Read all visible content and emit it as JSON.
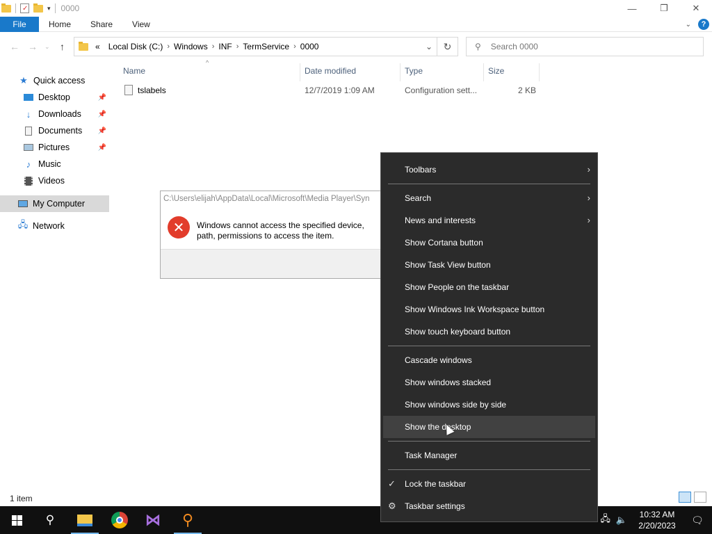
{
  "window": {
    "title": "0000",
    "controls": {
      "minimize_icon": "minimize-icon",
      "maximize_icon": "restore-icon",
      "close_icon": "close-icon"
    }
  },
  "ribbon": {
    "tabs": [
      {
        "label": "File"
      },
      {
        "label": "Home"
      },
      {
        "label": "Share"
      },
      {
        "label": "View"
      }
    ],
    "accent": "#1979ca"
  },
  "address": {
    "overflow": "«",
    "crumbs": [
      "Local Disk (C:)",
      "Windows",
      "INF",
      "TermService",
      "0000"
    ]
  },
  "search": {
    "placeholder": "Search 0000"
  },
  "sidebar": {
    "items": [
      {
        "label": "Quick access",
        "icon": "star-icon"
      },
      {
        "label": "Desktop",
        "icon": "desktop-icon",
        "pinned": true
      },
      {
        "label": "Downloads",
        "icon": "download-icon",
        "pinned": true
      },
      {
        "label": "Documents",
        "icon": "documents-icon",
        "pinned": true
      },
      {
        "label": "Pictures",
        "icon": "pictures-icon",
        "pinned": true
      },
      {
        "label": "Music",
        "icon": "music-icon"
      },
      {
        "label": "Videos",
        "icon": "videos-icon"
      },
      {
        "label": "My Computer",
        "icon": "computer-icon",
        "selected": true
      },
      {
        "label": "Network",
        "icon": "network-icon"
      }
    ]
  },
  "filelist": {
    "columns": [
      "Name",
      "Date modified",
      "Type",
      "Size"
    ],
    "rows": [
      {
        "name": "tslabels",
        "date": "12/7/2019 1:09 AM",
        "type": "Configuration sett...",
        "size": "2 KB"
      }
    ]
  },
  "error_dialog": {
    "path": "C:\\Users\\elijah\\AppData\\Local\\Microsoft\\Media Player\\Syn",
    "message": "Windows cannot access the specified device, path, permissions to access the item."
  },
  "status": {
    "item_count": "1 item"
  },
  "context_menu": {
    "items": {
      "toolbars": "Toolbars",
      "search": "Search",
      "news": "News and interests",
      "cortana": "Show Cortana button",
      "taskview": "Show Task View button",
      "people": "Show People on the taskbar",
      "ink": "Show Windows Ink Workspace button",
      "touch": "Show touch keyboard button",
      "cascade": "Cascade windows",
      "stacked": "Show windows stacked",
      "sidebyside": "Show windows side by side",
      "desktop": "Show the desktop",
      "taskmgr": "Task Manager",
      "lock": "Lock the taskbar",
      "settings": "Taskbar settings"
    },
    "hovered": "Show the desktop",
    "lock_checked": true
  },
  "taskbar": {
    "time": "10:32 AM",
    "date": "2/20/2023",
    "apps": [
      "start-icon",
      "search-icon",
      "file-explorer-icon",
      "chrome-icon",
      "visual-studio-icon",
      "magnifier-app-icon"
    ]
  }
}
